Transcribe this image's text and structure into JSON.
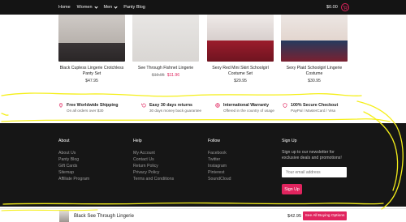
{
  "nav": {
    "items": [
      {
        "label": "Home",
        "dropdown": false
      },
      {
        "label": "Women",
        "dropdown": true
      },
      {
        "label": "Men",
        "dropdown": true
      },
      {
        "label": "Panty Blog",
        "dropdown": false
      }
    ],
    "cart_total": "$0.00",
    "cart_icon": "cart-icon"
  },
  "products": [
    {
      "title": "Black Cupless Lingerie Crotchless Panty Set",
      "price": "$47.95",
      "old_price": "",
      "sale_price": ""
    },
    {
      "title": "See Through Fishnet Lingerie",
      "price": "",
      "old_price": "$19.95",
      "sale_price": "$11.96"
    },
    {
      "title": "Sexy Red Mini Skirt Schoolgirl Costume Set",
      "price": "$29.95",
      "old_price": "",
      "sale_price": ""
    },
    {
      "title": "Sexy Plaid Schoolgirl Lingerie Costume",
      "price": "$30.95",
      "old_price": "",
      "sale_price": ""
    }
  ],
  "features": [
    {
      "icon": "map-pin-icon",
      "title": "Free Worldwide Shipping",
      "sub": "On all orders over $30"
    },
    {
      "icon": "return-arrow-icon",
      "title": "Easy 30 days returns",
      "sub": "30 days money back guarantee"
    },
    {
      "icon": "globe-icon",
      "title": "International Warranty",
      "sub": "Offered in the country of usage"
    },
    {
      "icon": "shield-icon",
      "title": "100% Secure Checkout",
      "sub": "PayPal / MasterCard / Visa"
    }
  ],
  "footer": {
    "about": {
      "heading": "About",
      "links": [
        "About Us",
        "Panty Blog",
        "Gift Cards",
        "Sitemap",
        "Affiliate Program"
      ]
    },
    "help": {
      "heading": "Help",
      "links": [
        "My Account",
        "Contact Us",
        "Return Policy",
        "Privacy Policy",
        "Terms and Conditions"
      ]
    },
    "follow": {
      "heading": "Follow",
      "links": [
        "Facebook",
        "Twitter",
        "Instagram",
        "Pinterest",
        "SoundCloud"
      ]
    },
    "signup": {
      "heading": "Sign Up",
      "text": "Sign up to our newsletter for exclusive deals and promotions!",
      "placeholder": "Your email address",
      "button": "Sign Up"
    }
  },
  "sticky": {
    "name": "Black See Through Lingerie",
    "price": "$42.95",
    "button": "See All Buying Options"
  },
  "colors": {
    "accent": "#e0245e",
    "footer_bg": "#161616",
    "annotation": "#f5ef1a"
  }
}
